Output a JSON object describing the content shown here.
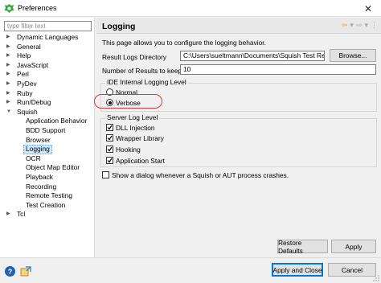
{
  "window": {
    "title": "Preferences",
    "close_glyph": "✕"
  },
  "sidebar": {
    "filter_placeholder": "type filter text",
    "items": [
      {
        "label": "Dynamic Languages",
        "level": 0,
        "expandable": true
      },
      {
        "label": "General",
        "level": 0,
        "expandable": true
      },
      {
        "label": "Help",
        "level": 0,
        "expandable": true
      },
      {
        "label": "JavaScript",
        "level": 0,
        "expandable": true
      },
      {
        "label": "Perl",
        "level": 0,
        "expandable": true
      },
      {
        "label": "PyDev",
        "level": 0,
        "expandable": true
      },
      {
        "label": "Ruby",
        "level": 0,
        "expandable": true
      },
      {
        "label": "Run/Debug",
        "level": 0,
        "expandable": true
      },
      {
        "label": "Squish",
        "level": 0,
        "expandable": true,
        "expanded": true
      },
      {
        "label": "Application Behavior",
        "level": 1
      },
      {
        "label": "BDD Support",
        "level": 1
      },
      {
        "label": "Browser",
        "level": 1
      },
      {
        "label": "Logging",
        "level": 1,
        "selected": true
      },
      {
        "label": "OCR",
        "level": 1
      },
      {
        "label": "Object Map Editor",
        "level": 1
      },
      {
        "label": "Playback",
        "level": 1
      },
      {
        "label": "Recording",
        "level": 1
      },
      {
        "label": "Remote Testing",
        "level": 1
      },
      {
        "label": "Test Creation",
        "level": 1
      },
      {
        "label": "Tcl",
        "level": 0,
        "expandable": true
      }
    ]
  },
  "page": {
    "title": "Logging",
    "description": "This page allows you to configure the logging behavior.",
    "result_logs_label": "Result Logs Directory",
    "result_logs_value": "C:\\Users\\sueltmann\\Documents\\Squish Test Results",
    "browse_label": "Browse...",
    "num_results_label": "Number of Results to keep",
    "num_results_value": "10",
    "ide_group": {
      "title": "IDE Internal Logging Level",
      "options": [
        {
          "label": "Normal",
          "selected": false
        },
        {
          "label": "Verbose",
          "selected": true
        }
      ]
    },
    "server_group": {
      "title": "Server Log Level",
      "options": [
        {
          "label": "DLL Injection",
          "checked": true
        },
        {
          "label": "Wrapper Library",
          "checked": true
        },
        {
          "label": "Hooking",
          "checked": true
        },
        {
          "label": "Application Start",
          "checked": true
        }
      ]
    },
    "crash_dialog": {
      "label": "Show a dialog whenever a Squish or AUT process crashes.",
      "checked": false
    },
    "restore_defaults_label": "Restore Defaults",
    "apply_label": "Apply"
  },
  "footer": {
    "apply_close_label": "Apply and Close",
    "cancel_label": "Cancel",
    "help_glyph": "?"
  },
  "colors": {
    "selection": "#cce8ff",
    "highlight_ring": "#d23a3a",
    "primary_border": "#0078d7"
  }
}
